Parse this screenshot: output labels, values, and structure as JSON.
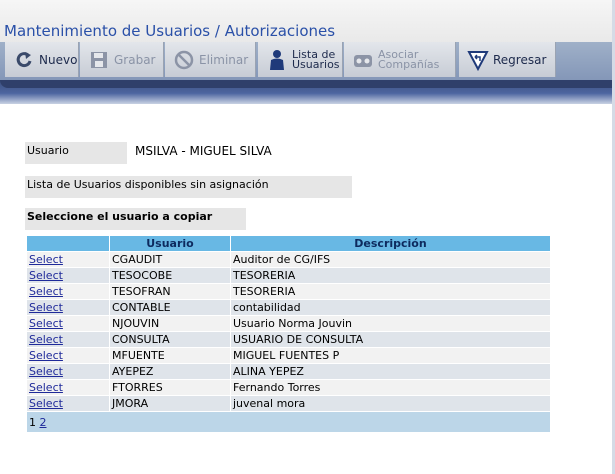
{
  "title": "Mantenimiento de Usuarios / Autorizaciones",
  "toolbar": {
    "nuevo": "Nuevo",
    "grabar": "Grabar",
    "eliminar": "Eliminar",
    "lista_line1": "Lista de",
    "lista_line2": "Usuarios",
    "asociar_line1": "Asociar",
    "asociar_line2": "Compañías",
    "regresar": "Regresar"
  },
  "form": {
    "usuario_label": "Usuario",
    "usuario_value": "MSILVA - MIGUEL SILVA",
    "lista_label": "Lista de Usuarios disponibles sin asignación",
    "seleccione_label": "Seleccione el usuario a copiar"
  },
  "table": {
    "headers": [
      "",
      "Usuario",
      "Descripción"
    ],
    "select_label": "Select",
    "rows": [
      {
        "usuario": "CGAUDIT",
        "descripcion": "Auditor de CG/IFS"
      },
      {
        "usuario": "TESOCOBE",
        "descripcion": "TESORERIA"
      },
      {
        "usuario": "TESOFRAN",
        "descripcion": "TESORERIA"
      },
      {
        "usuario": "CONTABLE",
        "descripcion": "contabilidad"
      },
      {
        "usuario": "NJOUVIN",
        "descripcion": "Usuario Norma Jouvin"
      },
      {
        "usuario": "CONSULTA",
        "descripcion": "USUARIO DE CONSULTA"
      },
      {
        "usuario": "MFUENTE",
        "descripcion": "MIGUEL FUENTES P"
      },
      {
        "usuario": "AYEPEZ",
        "descripcion": "ALINA YEPEZ"
      },
      {
        "usuario": "FTORRES",
        "descripcion": "Fernando Torres"
      },
      {
        "usuario": "JMORA",
        "descripcion": "juvenal mora"
      }
    ],
    "pager": {
      "current": "1",
      "next": "2"
    }
  },
  "colors": {
    "title": "#2a50a8",
    "header_bg": "#68b8e4",
    "link": "#1f2a9a",
    "band": "#3b4f7d"
  },
  "icons": [
    "refresh-icon",
    "save-icon",
    "delete-icon",
    "users-icon",
    "companies-icon",
    "return-icon"
  ]
}
